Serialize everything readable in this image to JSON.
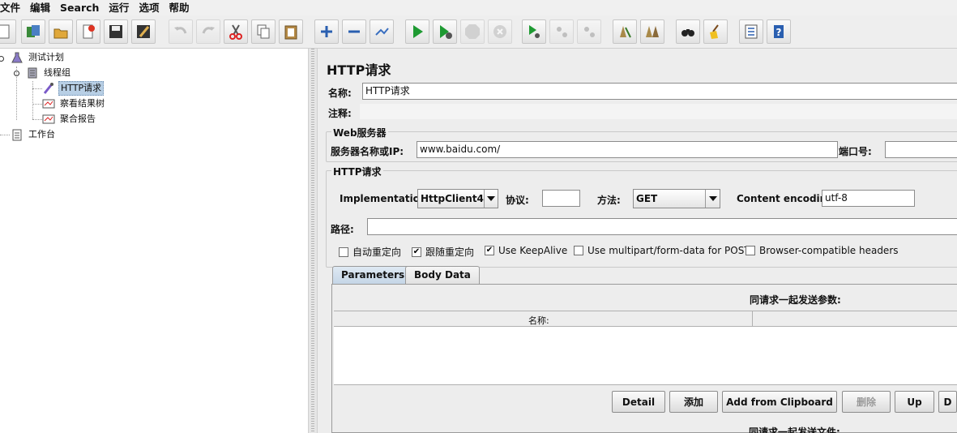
{
  "menu": [
    "文件",
    "编辑",
    "Search",
    "运行",
    "选项",
    "帮助"
  ],
  "toolbar_icons": [
    "new-icon",
    "templates-icon",
    "open-icon",
    "close-icon",
    "save-icon",
    "save-as-icon",
    "undo-icon",
    "redo-icon",
    "cut-icon",
    "copy-icon",
    "paste-icon",
    "expand-icon",
    "collapse-icon",
    "toggle-icon",
    "start-icon",
    "start-no-pause-icon",
    "stop-icon",
    "shutdown-icon",
    "remote-start-icon",
    "remote-stop-icon",
    "remote-shutdown-icon",
    "clear-icon",
    "clear-all-icon",
    "search-icon",
    "reset-search-icon",
    "function-helper-icon",
    "help-icon"
  ],
  "tree": {
    "test_plan": "测试计划",
    "thread_group": "线程组",
    "http_request": "HTTP请求",
    "view_results_tree": "察看结果树",
    "aggregate_report": "聚合报告",
    "workbench": "工作台"
  },
  "panel": {
    "title": "HTTP请求",
    "name_label": "名称:",
    "name_value": "HTTP请求",
    "comment_label": "注释:",
    "web_server_group": "Web服务器",
    "server_label": "服务器名称或IP:",
    "server_value": "www.baidu.com/",
    "port_label": "端口号:",
    "http_group": "HTTP请求",
    "impl_label": "Implementation:",
    "impl_value": "HttpClient4",
    "protocol_label": "协议:",
    "method_label": "方法:",
    "method_value": "GET",
    "encoding_label": "Content encoding:",
    "encoding_value": "utf-8",
    "path_label": "路径:",
    "checkboxes": [
      {
        "label": "自动重定向",
        "checked": false
      },
      {
        "label": "跟随重定向",
        "checked": true
      },
      {
        "label": "Use KeepAlive",
        "checked": true
      },
      {
        "label": "Use multipart/form-data for POST",
        "checked": false
      },
      {
        "label": "Browser-compatible headers",
        "checked": false
      }
    ],
    "tabs": [
      "Parameters",
      "Body Data"
    ],
    "params_title": "同请求一起发送参数:",
    "col_name": "名称:",
    "buttons": [
      "Detail",
      "添加",
      "Add from Clipboard",
      "删除",
      "Up",
      "D"
    ],
    "files_title": "同请求一起发送文件:"
  },
  "colors": {
    "selection": "#b8cfe5",
    "tab_active": "#c5d6e7",
    "run_green": "#1e9a32"
  }
}
